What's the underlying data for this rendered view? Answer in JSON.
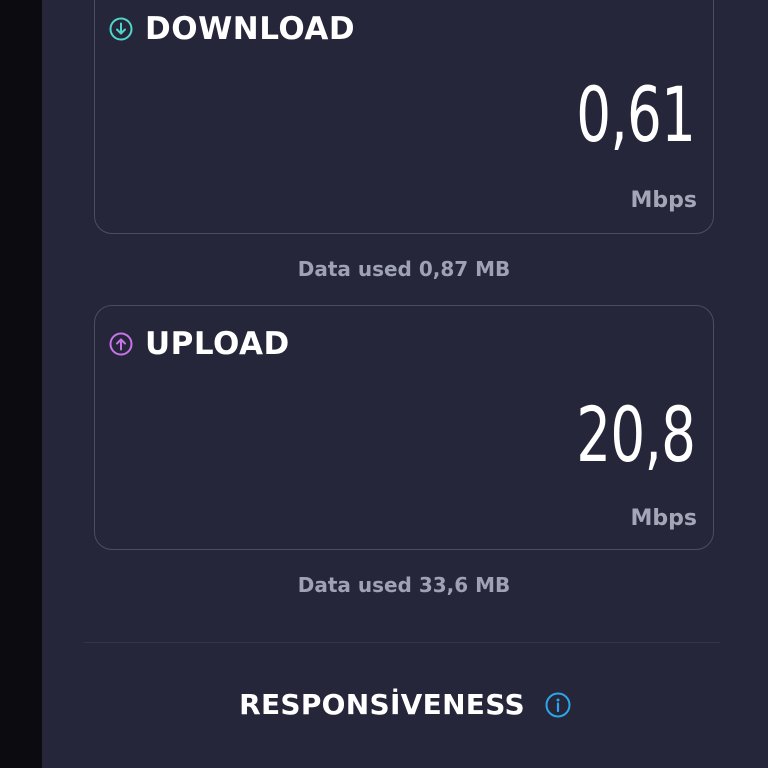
{
  "colors": {
    "background": "#25263a",
    "download_accent": "#4fd6c9",
    "upload_accent": "#c774e8",
    "info_accent": "#2ea5e8"
  },
  "download": {
    "icon": "arrow-down-circle-icon",
    "title": "DOWNLOAD",
    "value": "0,61",
    "unit": "Mbps",
    "data_used": "Data used 0,87 MB"
  },
  "upload": {
    "icon": "arrow-up-circle-icon",
    "title": "UPLOAD",
    "value": "20,8",
    "unit": "Mbps",
    "data_used": "Data used 33,6 MB"
  },
  "responsiveness": {
    "title": "RESPONSİVENESS",
    "icon": "info-icon"
  }
}
